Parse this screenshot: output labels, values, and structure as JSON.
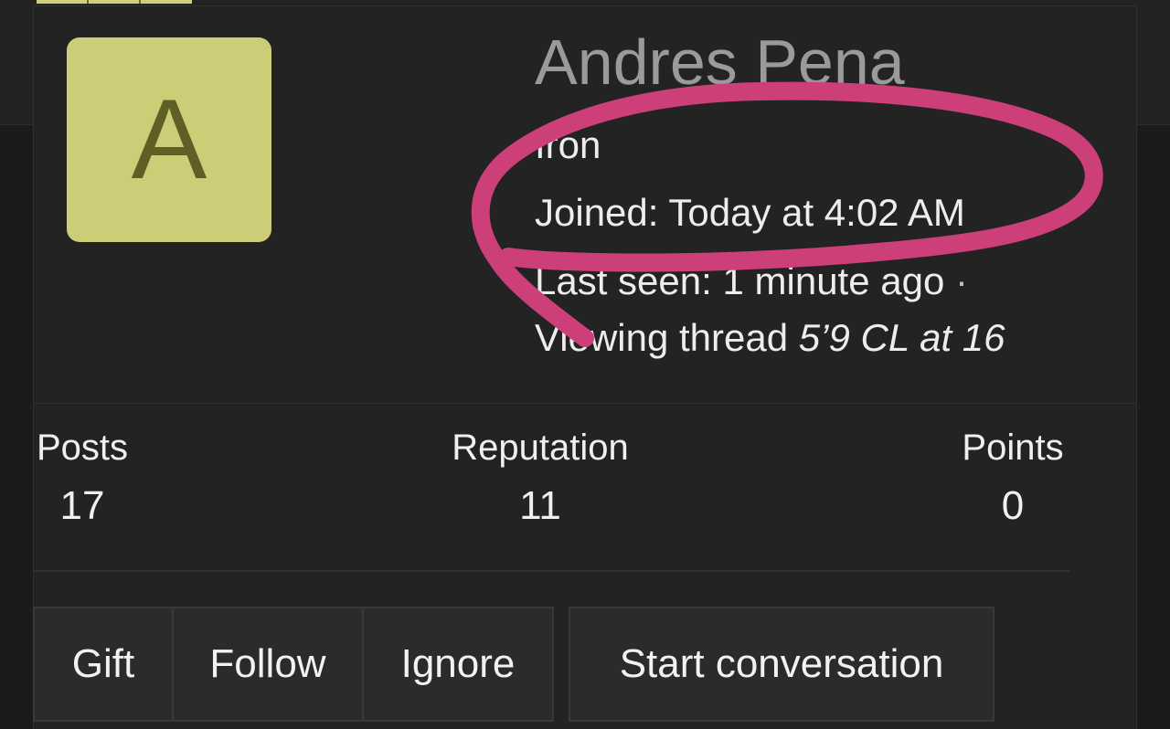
{
  "profile": {
    "avatar_letter": "A",
    "avatar_color": "#cdcd78",
    "username": "Andres Pena",
    "user_title": "Iron",
    "joined_label": "Joined:",
    "joined_value": "Today at 4:02 AM",
    "last_seen_label": "Last seen:",
    "last_seen_value": "1 minute ago",
    "separator": "·",
    "viewing_prefix": "Viewing thread",
    "viewing_thread": "5’9 CL at 16"
  },
  "stats": [
    {
      "label": "Posts",
      "value": "17"
    },
    {
      "label": "Reputation",
      "value": "11"
    },
    {
      "label": "Points",
      "value": "0"
    }
  ],
  "actions": {
    "gift": "Gift",
    "follow": "Follow",
    "ignore": "Ignore",
    "start_conversation": "Start conversation"
  },
  "annotation": {
    "color": "#cc3f78",
    "shape": "freehand-circle-around-joined"
  }
}
